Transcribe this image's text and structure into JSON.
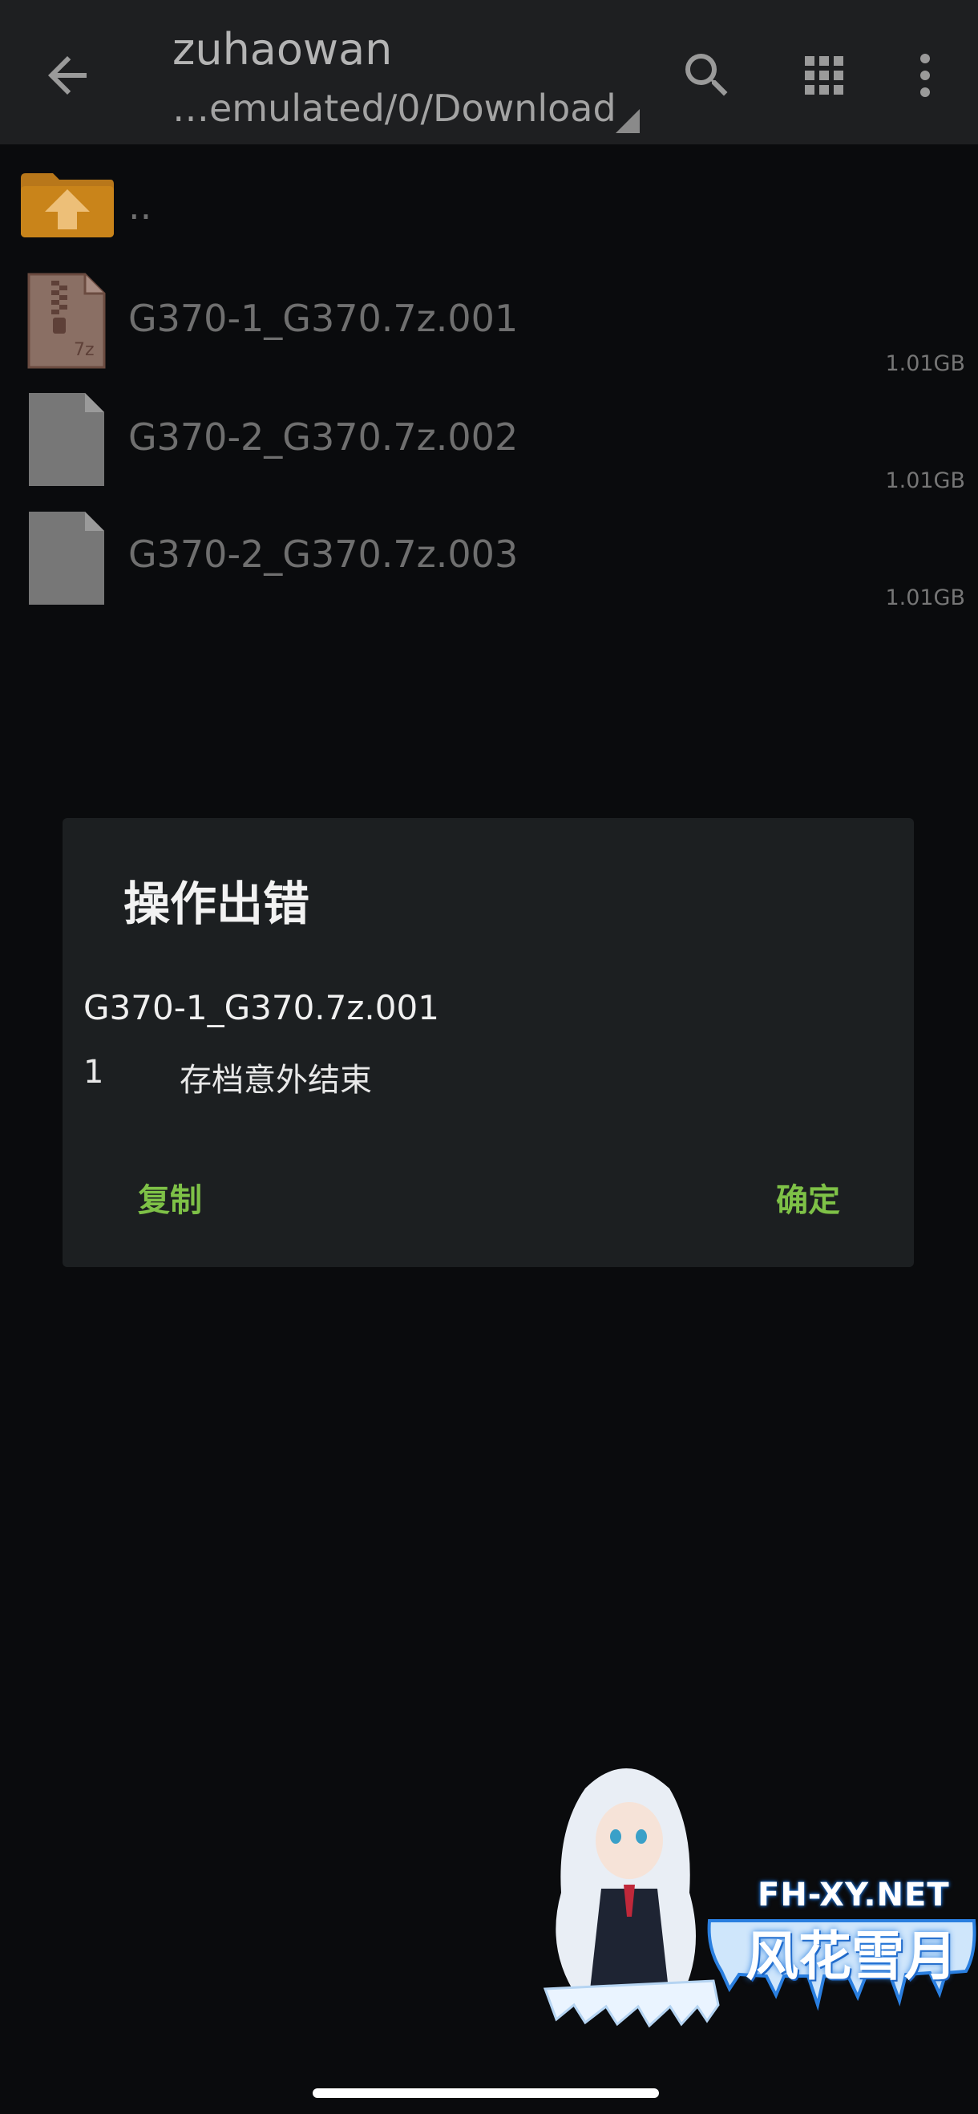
{
  "appbar": {
    "title": "zuhaowan",
    "path": "…emulated/0/Download",
    "icons": [
      "back-arrow-icon",
      "search-icon",
      "grid-view-icon",
      "more-vert-icon"
    ]
  },
  "files": [
    {
      "name": "..",
      "size": "",
      "icon": "folder-up-icon"
    },
    {
      "name": "G370-1_G370.7z.001",
      "size": "1.01GB",
      "icon": "7z-archive-icon",
      "icon_label": "7z"
    },
    {
      "name": "G370-2_G370.7z.002",
      "size": "1.01GB",
      "icon": "file-icon"
    },
    {
      "name": "G370-2_G370.7z.003",
      "size": "1.01GB",
      "icon": "file-icon"
    }
  ],
  "dialog": {
    "title": "操作出错",
    "filename": "G370-1_G370.7z.001",
    "error_code": "1",
    "error_message": "存档意外结束",
    "copy_label": "复制",
    "ok_label": "确定"
  },
  "watermark": {
    "url": "FH-XY.NET",
    "text": "风花雪月"
  },
  "colors": {
    "appbar_bg": "#1e1f21",
    "background": "#0a0b0d",
    "dialog_bg": "#1c1f21",
    "accent_green": "#7ec147",
    "folder_orange": "#c9841a"
  }
}
